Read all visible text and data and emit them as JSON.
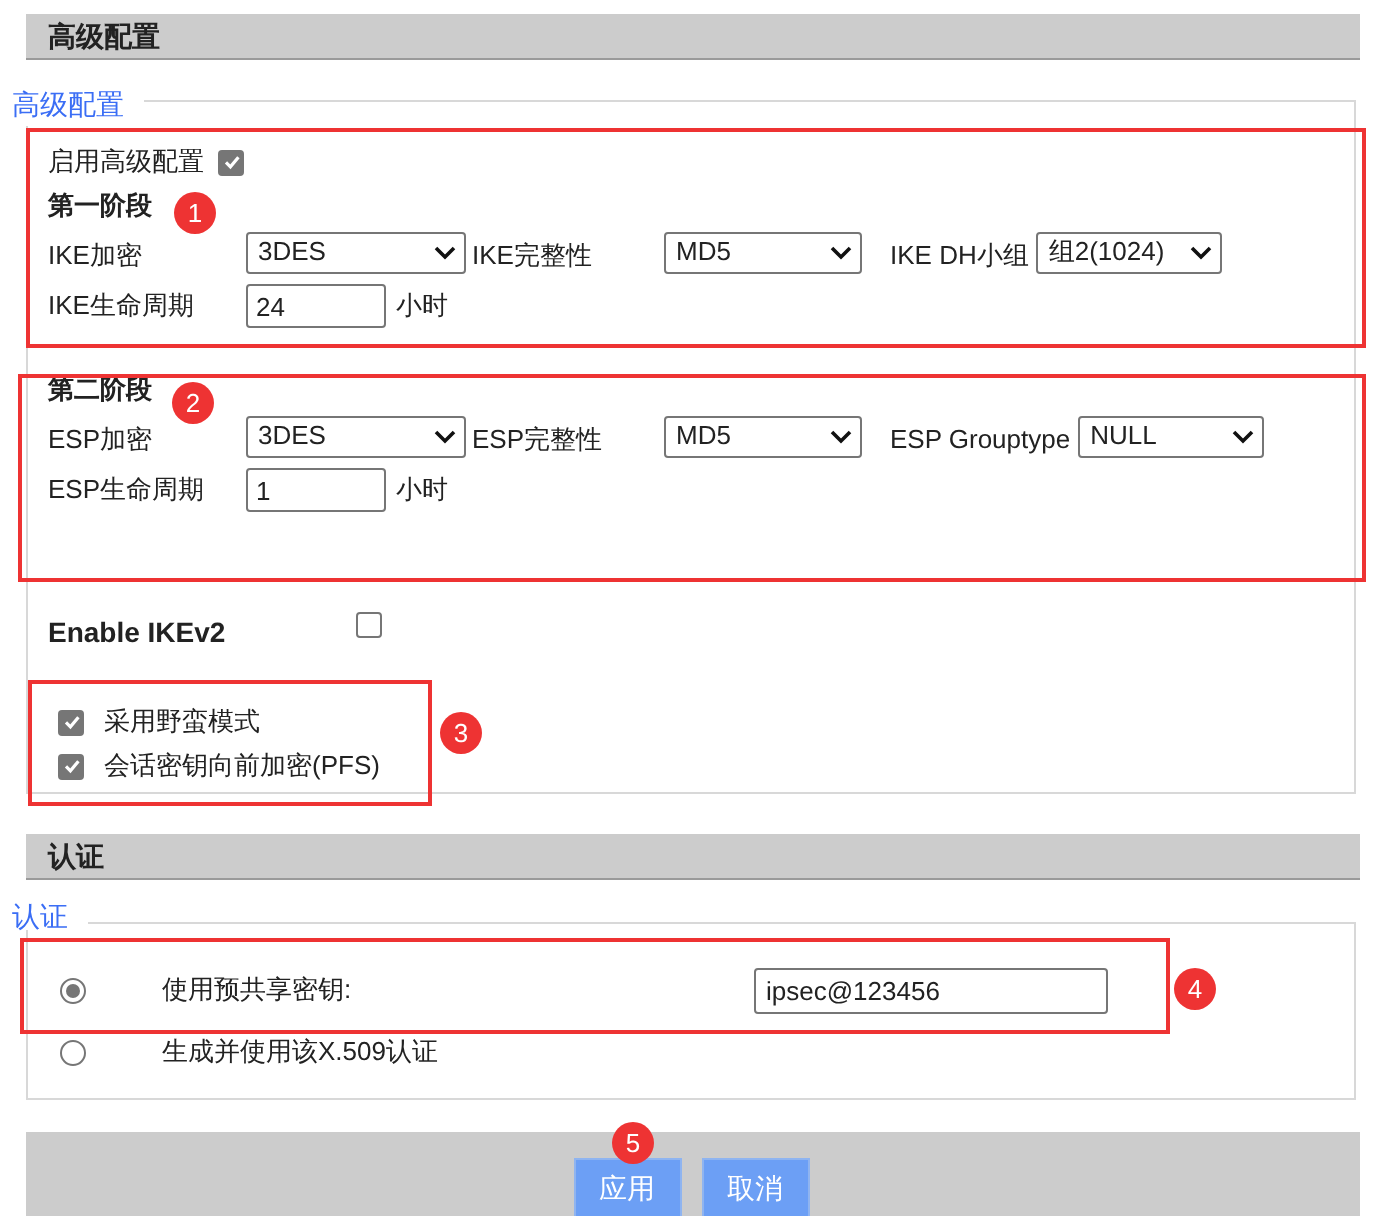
{
  "header": {
    "title": "高级配置"
  },
  "advanced": {
    "legend": "高级配置",
    "enable": {
      "label": "启用高级配置",
      "checked": true
    },
    "phases": [
      {
        "title": "第一阶段",
        "selects": [
          {
            "label": "IKE加密",
            "value": "3DES"
          },
          {
            "label": "IKE完整性",
            "value": "MD5"
          },
          {
            "label": "IKE DH小组",
            "value": "组2(1024)"
          }
        ],
        "lifetime": {
          "label": "IKE生命周期",
          "value": "24",
          "unit": "小时"
        }
      },
      {
        "title": "第二阶段",
        "selects": [
          {
            "label": "ESP加密",
            "value": "3DES"
          },
          {
            "label": "ESP完整性",
            "value": "MD5"
          },
          {
            "label": "ESP Grouptype",
            "value": "NULL"
          }
        ],
        "lifetime": {
          "label": "ESP生命周期",
          "value": "1",
          "unit": "小时"
        }
      }
    ],
    "ikev2": {
      "label": "Enable IKEv2",
      "checked": false
    },
    "options": [
      {
        "label": "采用野蛮模式",
        "checked": true
      },
      {
        "label": "会话密钥向前加密(PFS)",
        "checked": true
      }
    ]
  },
  "auth_header": {
    "title": "认证"
  },
  "auth": {
    "legend": "认证",
    "options": [
      {
        "label": "使用预共享密钥:",
        "selected": true,
        "value": "ipsec@123456"
      },
      {
        "label": "生成并使用该X.509认证",
        "selected": false
      }
    ]
  },
  "buttons": [
    {
      "label": "应用"
    },
    {
      "label": "取消"
    }
  ],
  "annotations": [
    {
      "number": "1"
    },
    {
      "number": "2"
    },
    {
      "number": "3"
    },
    {
      "number": "4"
    },
    {
      "number": "5"
    }
  ]
}
